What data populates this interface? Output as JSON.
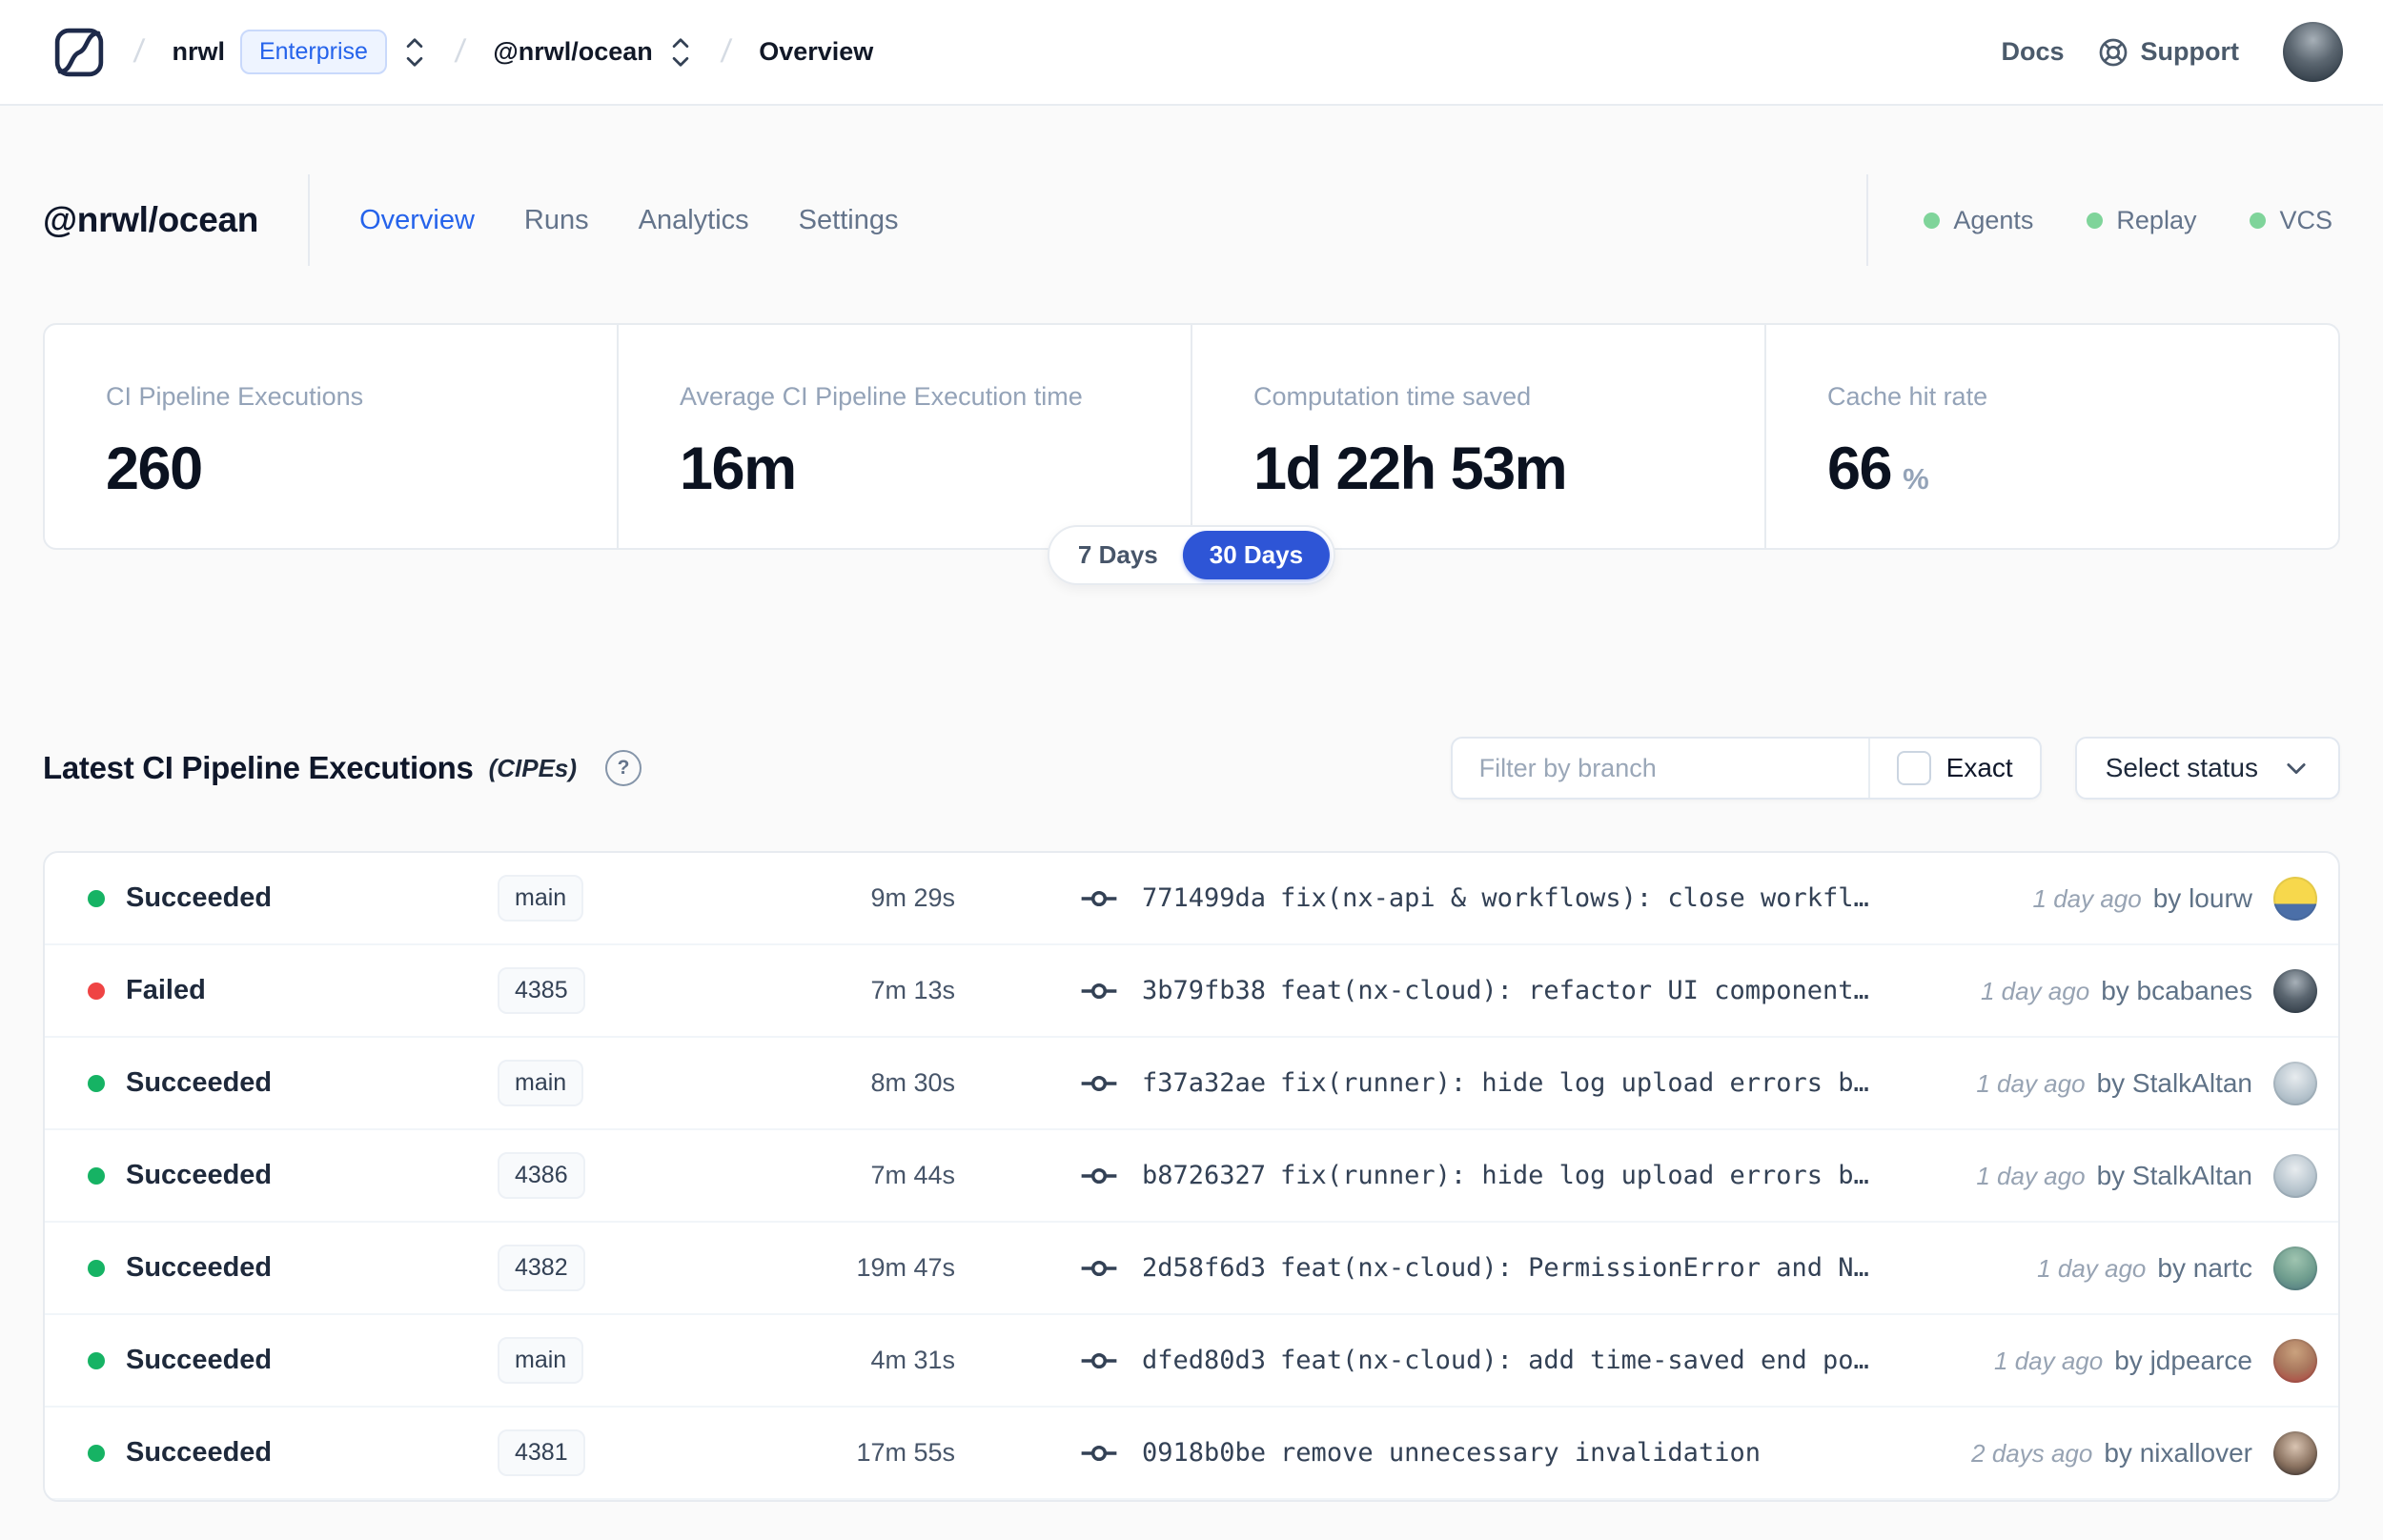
{
  "nav": {
    "breadcrumb": {
      "separator": "/",
      "org": "nrwl",
      "plan_badge": "Enterprise",
      "workspace": "@nrwl/ocean",
      "page": "Overview"
    },
    "docs_label": "Docs",
    "support_label": "Support",
    "user_avatar_bg": "radial-gradient(circle at 50% 30%, #a7b0b8 0%, #5b6670 45%, #232e39 100%)"
  },
  "header": {
    "workspace_title": "@nrwl/ocean",
    "tabs": [
      {
        "label": "Overview",
        "active": true
      },
      {
        "label": "Runs",
        "active": false
      },
      {
        "label": "Analytics",
        "active": false
      },
      {
        "label": "Settings",
        "active": false
      }
    ],
    "indicators": [
      {
        "label": "Agents"
      },
      {
        "label": "Replay"
      },
      {
        "label": "VCS"
      }
    ]
  },
  "stats": {
    "cards": [
      {
        "label": "CI Pipeline Executions",
        "value": "260"
      },
      {
        "label": "Average CI Pipeline Execution time",
        "value": "16m"
      },
      {
        "label": "Computation time saved",
        "value": "1d 22h 53m"
      },
      {
        "label": "Cache hit rate",
        "value": "66",
        "unit": "%"
      }
    ],
    "range_toggle": {
      "options": [
        "7 Days",
        "30 Days"
      ],
      "selected": "30 Days"
    }
  },
  "cipe_section": {
    "title": "Latest CI Pipeline Executions",
    "title_suffix": "(CIPEs)",
    "help_glyph": "?",
    "filter": {
      "placeholder": "Filter by branch",
      "exact_label": "Exact",
      "status_label": "Select status"
    },
    "rows": [
      {
        "status": "Succeeded",
        "status_color": "#16b364",
        "branch": "main",
        "duration": "9m 29s",
        "commit_hash": "771499da",
        "commit_message": "fix(nx-api & workflows): close workfl…",
        "time_ago": "1 day ago",
        "author": "by lourw",
        "avatar_bg": "linear-gradient(180deg, #f7d84c 62%, #4b6fa8 62%)"
      },
      {
        "status": "Failed",
        "status_color": "#ef4444",
        "branch": "4385",
        "duration": "7m 13s",
        "commit_hash": "3b79fb38",
        "commit_message": "feat(nx-cloud): refactor UI component…",
        "time_ago": "1 day ago",
        "author": "by bcabanes",
        "avatar_bg": "radial-gradient(circle at 50% 30%, #a7b0b8 0%, #5b6670 45%, #232e39 100%)"
      },
      {
        "status": "Succeeded",
        "status_color": "#16b364",
        "branch": "main",
        "duration": "8m 30s",
        "commit_hash": "f37a32ae",
        "commit_message": "fix(runner): hide log upload errors b…",
        "time_ago": "1 day ago",
        "author": "by StalkAltan",
        "avatar_bg": "radial-gradient(circle at 50% 35%, #e8ecef 0%, #b9c6cf 55%, #8fa2ae 100%)"
      },
      {
        "status": "Succeeded",
        "status_color": "#16b364",
        "branch": "4386",
        "duration": "7m 44s",
        "commit_hash": "b8726327",
        "commit_message": "fix(runner): hide log upload errors b…",
        "time_ago": "1 day ago",
        "author": "by StalkAltan",
        "avatar_bg": "radial-gradient(circle at 50% 35%, #e8ecef 0%, #b9c6cf 55%, #8fa2ae 100%)"
      },
      {
        "status": "Succeeded",
        "status_color": "#16b364",
        "branch": "4382",
        "duration": "19m 47s",
        "commit_hash": "2d58f6d3",
        "commit_message": "feat(nx-cloud): PermissionError and N…",
        "time_ago": "1 day ago",
        "author": "by nartc",
        "avatar_bg": "radial-gradient(circle at 50% 30%, #9fc4b0 0%, #6f9d8e 55%, #49707c 100%)"
      },
      {
        "status": "Succeeded",
        "status_color": "#16b364",
        "branch": "main",
        "duration": "4m 31s",
        "commit_hash": "dfed80d3",
        "commit_message": "feat(nx-cloud): add time-saved end po…",
        "time_ago": "1 day ago",
        "author": "by jdpearce",
        "avatar_bg": "radial-gradient(circle at 50% 30%, #caa27e 0%, #a9775d 50%, #b03a3a 100%)"
      },
      {
        "status": "Succeeded",
        "status_color": "#16b364",
        "branch": "4381",
        "duration": "17m 55s",
        "commit_hash": "0918b0be",
        "commit_message": "remove unnecessary invalidation",
        "time_ago": "2 days ago",
        "author": "by nixallover",
        "avatar_bg": "radial-gradient(circle at 50% 35%, #d9c4b2 0%, #8a7260 55%, #2e2624 100%)"
      }
    ]
  },
  "colors": {
    "accent_blue": "#2e55d6",
    "tab_active_blue": "#2563eb",
    "success_green": "#16b364",
    "failed_red": "#ef4444",
    "indicator_green": "#7fd49a"
  }
}
